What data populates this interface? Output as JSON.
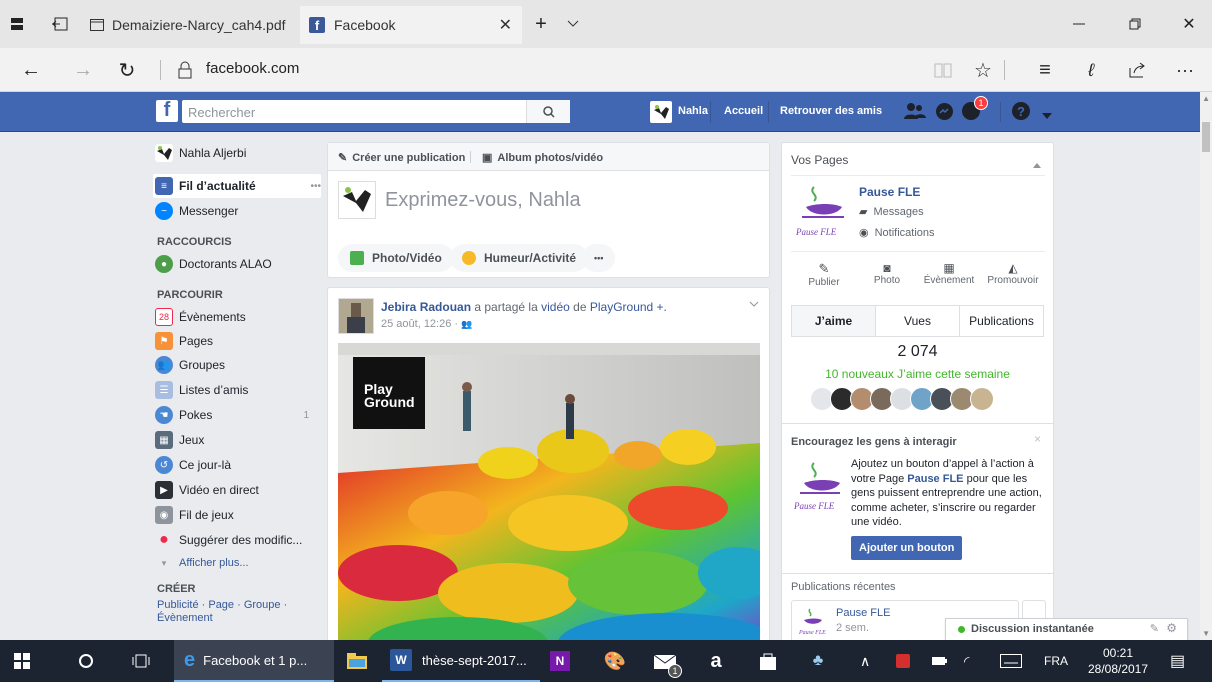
{
  "browser": {
    "tabs": [
      {
        "title": "Demaiziere-Narcy_cah4.pdf"
      },
      {
        "title": "Facebook"
      }
    ],
    "url": "facebook.com"
  },
  "fb_bar": {
    "search_placeholder": "Rechercher",
    "user": "Nahla",
    "home": "Accueil",
    "find_friends": "Retrouver des amis",
    "notif_count": "1"
  },
  "left_nav": {
    "profile": "Nahla Aljerbi",
    "items_top": [
      {
        "label": "Fil d’actualité",
        "extra": "•••"
      },
      {
        "label": "Messenger"
      }
    ],
    "shortcuts_title": "RACCOURCIS",
    "shortcuts": [
      {
        "label": "Doctorants ALAO"
      }
    ],
    "explore_title": "PARCOURIR",
    "explore": [
      {
        "label": "Évènements",
        "badge": "28"
      },
      {
        "label": "Pages"
      },
      {
        "label": "Groupes"
      },
      {
        "label": "Listes d’amis"
      },
      {
        "label": "Pokes",
        "count": "1"
      },
      {
        "label": "Jeux"
      },
      {
        "label": "Ce jour-là"
      },
      {
        "label": "Vidéo en direct"
      },
      {
        "label": "Fil de jeux"
      },
      {
        "label": "Suggérer des modific..."
      }
    ],
    "show_more": "Afficher plus...",
    "create_title": "CRÉER",
    "create_links": "Publicité · Page · Groupe · Évènement"
  },
  "composer": {
    "create_post": "Créer une publication",
    "album": "Album photos/vidéo",
    "prompt": "Exprimez-vous, Nahla",
    "photo_video": "Photo/Vidéo",
    "mood": "Humeur/Activité",
    "more": "•••"
  },
  "post": {
    "author": "Jebira Radouan",
    "shared": "a partagé la",
    "video": "vidéo",
    "de": "de",
    "page": "PlayGround +.",
    "time": "25 août, 12:26 ·",
    "logo_line1": "Play",
    "logo_line2": "Ground"
  },
  "pages_panel": {
    "title": "Vos Pages",
    "page_name": "Pause FLE",
    "messages": "Messages",
    "notifications": "Notifications",
    "actions": [
      "Publier",
      "Photo",
      "Évènement",
      "Promouvoir"
    ],
    "tabs": [
      "J’aime",
      "Vues",
      "Publications"
    ],
    "likes": "2 074",
    "new_likes": "10 nouveaux J’aime cette semaine",
    "encourage_title": "Encouragez les gens à interagir",
    "encourage_text_1": "Ajoutez un bouton d’appel à l’action à votre Page",
    "encourage_page": "Pause FLE",
    "encourage_text_2": "pour que les gens puissent entreprendre une action, comme acheter, s’inscrire ou regarder une vidéo.",
    "add_button": "Ajouter un bouton",
    "recent_title": "Publications récentes",
    "recent_page": "Pause FLE",
    "recent_time": "2 sem."
  },
  "chat": {
    "label": "Discussion instantanée"
  },
  "taskbar": {
    "edge_label": "Facebook et 1 p...",
    "word_label": "thèse-sept-2017...",
    "mail_badge": "1",
    "lang": "FRA",
    "time": "00:21",
    "date": "28/08/2017"
  },
  "colors": {
    "fb_blue": "#4267b2",
    "link": "#365899",
    "taskbar": "#1c2331"
  }
}
